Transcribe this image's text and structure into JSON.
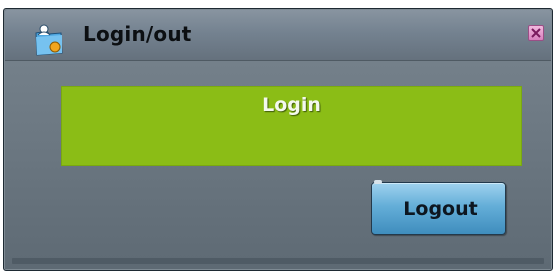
{
  "window": {
    "title": "Login/out",
    "icon": "folder-user-icon",
    "close_icon": "close-x-icon"
  },
  "status": {
    "text": "Login",
    "background_color": "#8bbd16"
  },
  "actions": {
    "logout_label": "Logout",
    "logout_color": "#64aed8"
  }
}
